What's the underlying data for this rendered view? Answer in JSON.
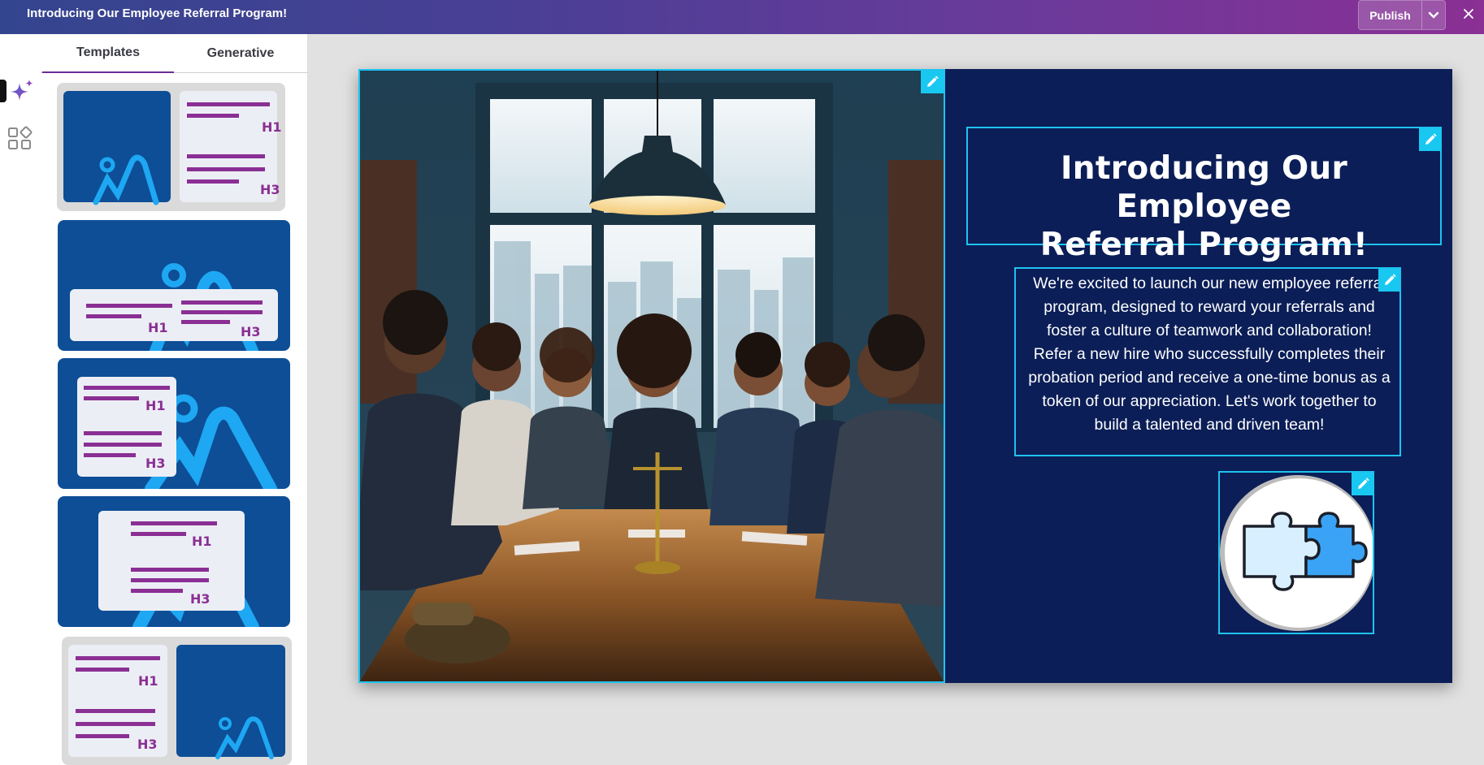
{
  "app": {
    "title": "Introducing Our Employee Referral Program!",
    "publish_label": "Publish"
  },
  "colors": {
    "accent": "#18c8f0",
    "slide_bg": "#0b1e57",
    "template_blue": "#0d4e96",
    "template_purple": "#8a2f94"
  },
  "sidebar": {
    "tabs": [
      {
        "label": "Templates",
        "active": true
      },
      {
        "label": "Generative",
        "active": false
      }
    ],
    "rail_icons": [
      "ai-sparkle-icon",
      "templates-grid-icon"
    ],
    "template_thumb_labels": {
      "h1": "H1",
      "h3": "H3"
    }
  },
  "slide": {
    "image": "team-meeting-photo",
    "heading": "Introducing Our Employee Referral Program!",
    "heading_lines": [
      "Introducing Our Employee",
      "Referral Program!"
    ],
    "body_lines": [
      "We're excited to launch our new employee referral",
      "program, designed to reward your referrals and",
      "foster a culture of teamwork and collaboration!",
      "Refer a new hire who successfully completes their",
      "probation period and receive a one-time bonus as a",
      "token of our appreciation. Let's work together to",
      "build a talented and driven team!"
    ],
    "icon": "puzzle-pieces-icon"
  }
}
